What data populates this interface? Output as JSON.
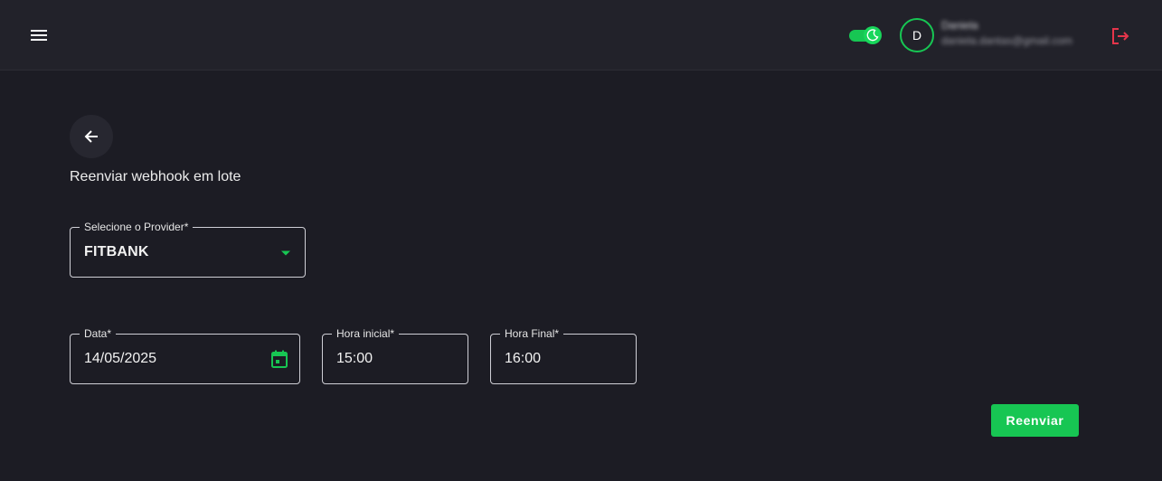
{
  "header": {
    "avatar_initial": "D",
    "user_name": "Daniela",
    "user_email": "daniela.dantas@gmail.com",
    "theme_toggle": {
      "state": "on",
      "mode_icon": "moon-icon"
    }
  },
  "page": {
    "title": "Reenviar webhook em lote"
  },
  "form": {
    "provider": {
      "label": "Selecione o Provider*",
      "value": "FITBANK"
    },
    "date": {
      "label": "Data*",
      "value": "14/05/2025"
    },
    "start_time": {
      "label": "Hora inicial*",
      "value": "15:00"
    },
    "end_time": {
      "label": "Hora Final*",
      "value": "16:00"
    },
    "submit_label": "Reenviar"
  },
  "icons": {
    "menu": "menu-icon",
    "back": "arrow-left-icon",
    "logout": "logout-icon",
    "dropdown": "caret-down-icon",
    "calendar": "calendar-icon"
  },
  "colors": {
    "background": "#1c1c24",
    "topbar": "#22222a",
    "accent": "#17c653",
    "logout": "#e5354b",
    "field_border": "#cfcfd6"
  }
}
